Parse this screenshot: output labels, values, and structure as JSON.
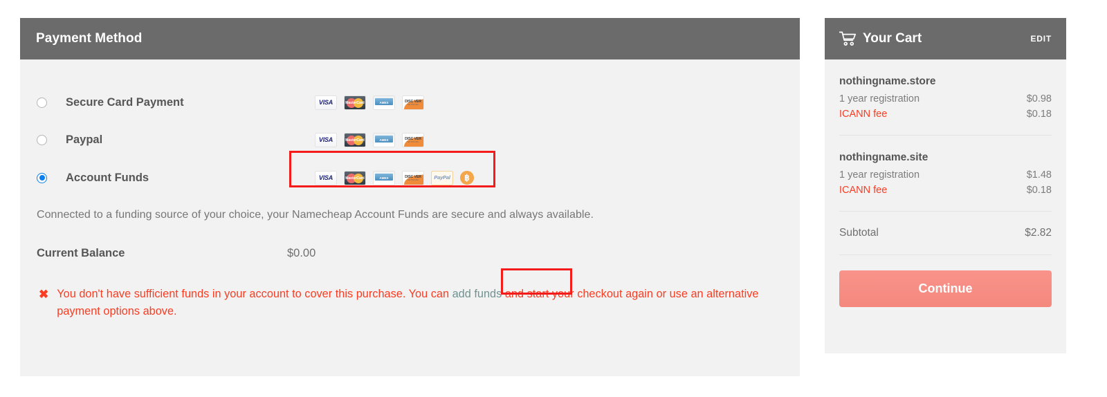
{
  "payment_panel": {
    "header_title": "Payment Method",
    "options": [
      {
        "label": "Secure Card Payment",
        "selected": false,
        "logos": [
          "visa",
          "mastercard",
          "amex",
          "discover"
        ]
      },
      {
        "label": "Paypal",
        "selected": false,
        "logos": [
          "visa",
          "mastercard",
          "amex",
          "discover"
        ]
      },
      {
        "label": "Account Funds",
        "selected": true,
        "logos": [
          "visa",
          "mastercard",
          "amex",
          "discover",
          "paypal",
          "bitcoin"
        ]
      }
    ],
    "description": "Connected to a funding source of your choice, your Namecheap Account Funds are secure and always available.",
    "balance_label": "Current Balance",
    "balance_value": "$0.00",
    "error": {
      "icon": "✖",
      "text_before": "You don't have sufficient funds in your account to cover this purchase. You can ",
      "link_text": "add funds",
      "text_after": " and start your checkout again or use an alternative payment options above."
    },
    "logo_labels": {
      "visa": "VISA",
      "mastercard": "MasterCard",
      "amex": "AMERICAN EXPRESS",
      "discover_top": "DISC VER",
      "discover_sub": "NETWORK",
      "paypal": "PayPal",
      "bitcoin": "฿"
    }
  },
  "cart_panel": {
    "header_title": "Your Cart",
    "edit_label": "EDIT",
    "items": [
      {
        "domain": "nothingname.store",
        "lines": [
          {
            "desc": "1 year registration",
            "price": "$0.98",
            "fee": false
          },
          {
            "desc": "ICANN fee",
            "price": "$0.18",
            "fee": true
          }
        ]
      },
      {
        "domain": "nothingname.site",
        "lines": [
          {
            "desc": "1 year registration",
            "price": "$1.48",
            "fee": false
          },
          {
            "desc": "ICANN fee",
            "price": "$0.18",
            "fee": true
          }
        ]
      }
    ],
    "subtotal_label": "Subtotal",
    "subtotal_value": "$2.82",
    "continue_label": "Continue"
  },
  "colors": {
    "header_gray": "#6b6b6b",
    "panel_bg": "#f2f2f2",
    "error_red": "#fa3c22",
    "link_teal": "#6f9391",
    "continue_salmon": "#f4887e",
    "radio_blue": "#0a7ff0",
    "annotation_red": "#f41b1b"
  }
}
